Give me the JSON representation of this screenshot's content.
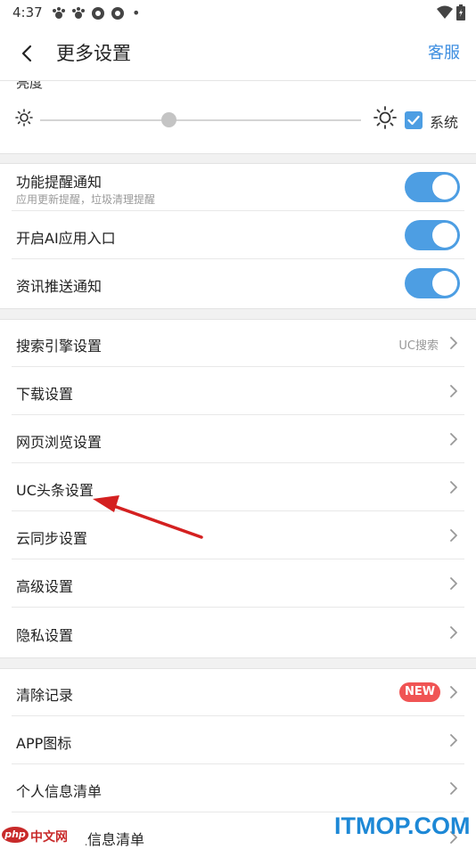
{
  "status_bar": {
    "time": "4:37",
    "dot": "•"
  },
  "header": {
    "title": "更多设置",
    "service_label": "客服"
  },
  "brightness": {
    "label": "亮度",
    "level": 0.4,
    "system_checked": true,
    "system_label": "系统"
  },
  "notifications": [
    {
      "title": "功能提醒通知",
      "subtitle": "应用更新提醒，垃圾清理提醒",
      "enabled": true
    },
    {
      "title": "开启AI应用入口",
      "enabled": true
    },
    {
      "title": "资讯推送通知",
      "enabled": true
    }
  ],
  "settings": [
    {
      "title": "搜索引擎设置",
      "value": "UC搜索"
    },
    {
      "title": "下载设置"
    },
    {
      "title": "网页浏览设置"
    },
    {
      "title": "UC头条设置"
    },
    {
      "title": "云同步设置"
    },
    {
      "title": "高级设置"
    },
    {
      "title": "隐私设置"
    }
  ],
  "more": [
    {
      "title": "清除记录",
      "badge": "NEW"
    },
    {
      "title": "APP图标"
    },
    {
      "title": "个人信息清单"
    },
    {
      "title": "第三方个人信息清单"
    }
  ],
  "watermark": {
    "left_logo": "php",
    "left_text": "中文网",
    "right_text": "ITMOP.COM"
  },
  "colors": {
    "accent": "#4d9ee3",
    "link": "#3d8ee0",
    "badge": "#f05454",
    "arrow": "#d42020"
  }
}
